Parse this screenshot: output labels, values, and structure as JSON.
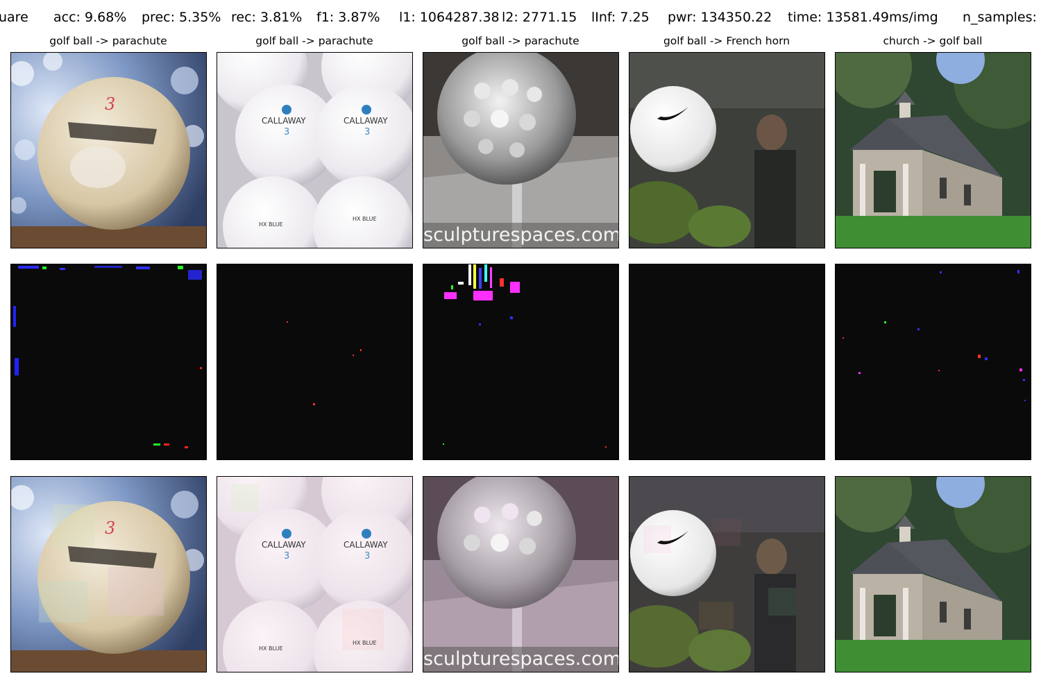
{
  "header": {
    "method": "uare",
    "acc": "acc: 9.68%",
    "prec": "prec: 5.35%",
    "rec": "rec: 3.81%",
    "f1": "f1: 3.87%",
    "l1": "l1: 1064287.38",
    "l2": "l2: 2771.15",
    "linf": "lInf: 7.25",
    "pwr": "pwr: 134350.22",
    "time": "time: 13581.49ms/img",
    "n_samples": "n_samples:"
  },
  "columns": [
    {
      "title": "golf ball -> parachute"
    },
    {
      "title": "golf ball -> parachute"
    },
    {
      "title": "golf ball -> parachute"
    },
    {
      "title": "golf ball -> French horn"
    },
    {
      "title": "church -> golf ball"
    }
  ],
  "images": {
    "callaway_text": "CALLAWAY",
    "callaway_num": "3",
    "hx_blue": "HX BLUE",
    "number_3": "3",
    "watermark": "sculpturespaces.com"
  },
  "colors": {
    "background": "#ffffff",
    "noise_background": "#0a0a0a"
  }
}
